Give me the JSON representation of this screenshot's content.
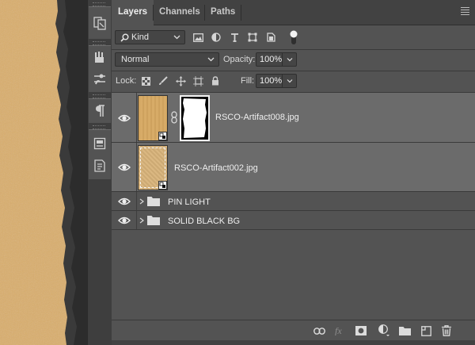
{
  "tabs": [
    {
      "label": "Layers",
      "active": true
    },
    {
      "label": "Channels",
      "active": false
    },
    {
      "label": "Paths",
      "active": false
    }
  ],
  "filter": {
    "kind_label": "Kind"
  },
  "blend": {
    "mode": "Normal",
    "opacity_label": "Opacity:",
    "opacity_value": "100%"
  },
  "lock": {
    "label": "Lock:",
    "fill_label": "Fill:",
    "fill_value": "100%"
  },
  "layers": [
    {
      "name": "RSCO-Artifact008.jpg",
      "type": "image-with-mask",
      "visible": true,
      "selected": true
    },
    {
      "name": "RSCO-Artifact002.jpg",
      "type": "image",
      "visible": true,
      "selected": true
    },
    {
      "name": "PIN LIGHT",
      "type": "group",
      "visible": true,
      "selected": false
    },
    {
      "name": "SOLID BLACK BG",
      "type": "group",
      "visible": true,
      "selected": false
    }
  ],
  "bottom_icons": [
    "link-layers-icon",
    "fx-icon",
    "add-mask-icon",
    "adjustment-layer-icon",
    "new-group-icon",
    "new-layer-icon",
    "trash-icon"
  ],
  "colors": {
    "panel_bg": "#535353",
    "selected_row": "#6b6b6b",
    "paper": "#d9ae6c",
    "dark_strip": "#303030"
  }
}
